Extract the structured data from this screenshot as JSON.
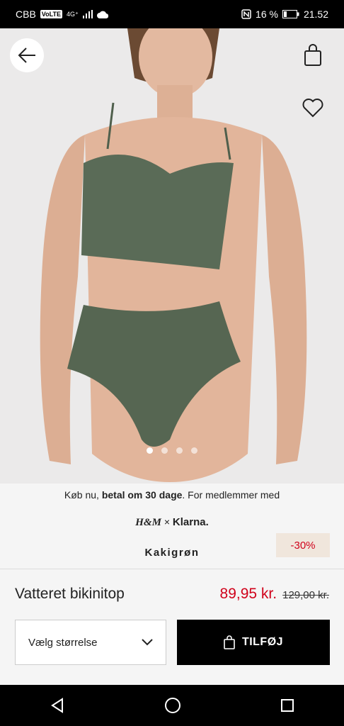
{
  "status_bar": {
    "carrier": "CBB",
    "volte": "VoLTE",
    "network": "4G⁺",
    "battery_percent": "16 %",
    "time": "21.52"
  },
  "gallery": {
    "page_count": 4,
    "current_page": 1
  },
  "promo": {
    "prefix": "Køb nu, ",
    "bold": "betal om 30 dage",
    "suffix": ". For medlemmer med",
    "hm_logo": "H&M",
    "times": "×",
    "klarna": "Klarna."
  },
  "product": {
    "color_name": "Kakigrøn",
    "discount": "-30%",
    "name": "Vatteret bikinitop",
    "price": "89,95 kr.",
    "old_price": "129,00 kr."
  },
  "actions": {
    "size_placeholder": "Vælg størrelse",
    "add_label": "TILFØJ"
  },
  "colors": {
    "sale_red": "#d0021b",
    "swimwear_green": "#5a6b57",
    "discount_bg": "#f0e6dc"
  },
  "icons": [
    "back-arrow-icon",
    "shopping-bag-icon",
    "heart-icon",
    "chevron-down-icon",
    "bag-icon",
    "nav-back-icon",
    "nav-home-icon",
    "nav-recents-icon"
  ]
}
